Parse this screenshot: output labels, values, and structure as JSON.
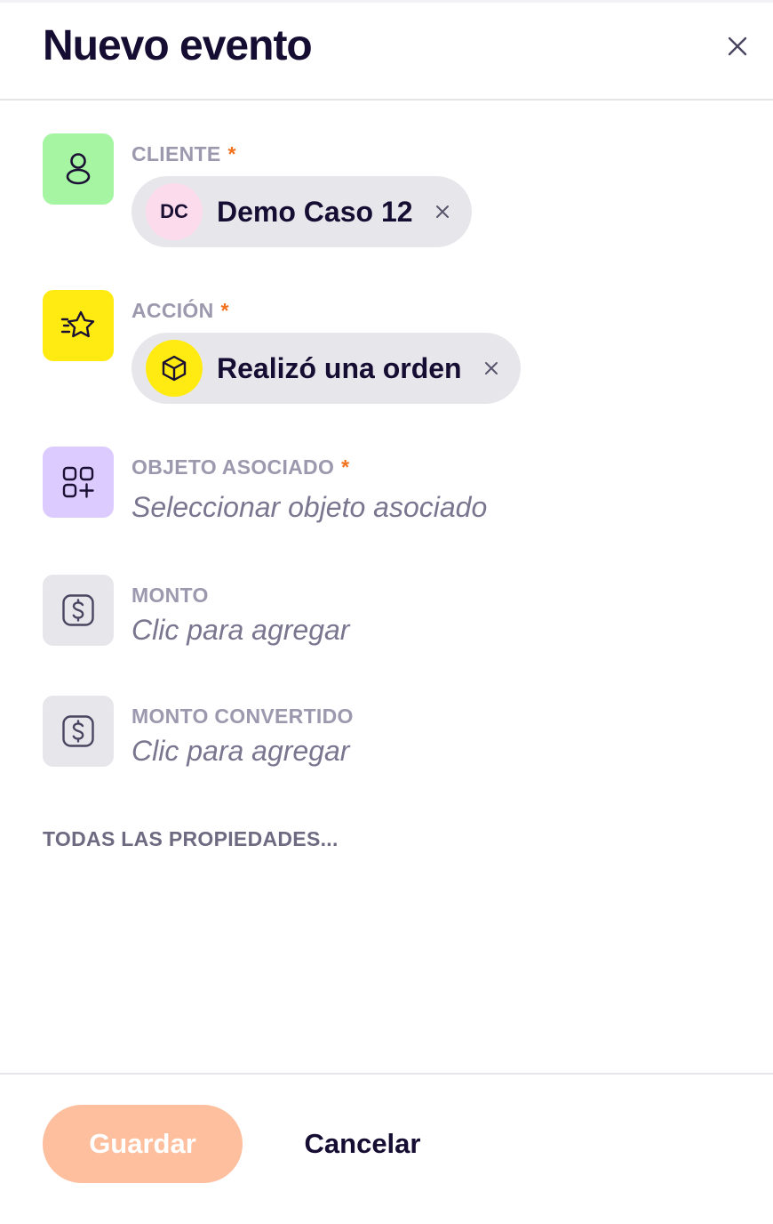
{
  "header": {
    "title": "Nuevo evento",
    "close_icon": "close-icon"
  },
  "fields": {
    "cliente": {
      "label": "CLIENTE",
      "required_mark": "*",
      "icon": "user-icon",
      "icon_bg": "#a6f5a2",
      "chip": {
        "avatar_text": "DC",
        "avatar_bg": "#fcdcec",
        "value": "Demo Caso 12"
      }
    },
    "accion": {
      "label": "ACCIÓN",
      "required_mark": "*",
      "icon": "star-motion-icon",
      "icon_bg": "#ffea12",
      "chip": {
        "avatar_icon": "box-icon",
        "avatar_bg": "#ffea12",
        "value": "Realizó una orden"
      }
    },
    "objeto": {
      "label": "OBJETO ASOCIADO",
      "required_mark": "*",
      "icon": "apps-add-icon",
      "icon_bg": "#dccbff",
      "placeholder": "Seleccionar objeto asociado"
    },
    "monto": {
      "label": "MONTO",
      "icon": "dollar-icon",
      "icon_bg": "#e7e6eb",
      "placeholder": "Clic para agregar"
    },
    "monto_convertido": {
      "label": "MONTO CONVERTIDO",
      "icon": "dollar-icon",
      "icon_bg": "#e7e6eb",
      "placeholder": "Clic para agregar"
    }
  },
  "all_properties_link": "TODAS LAS PROPIEDADES...",
  "footer": {
    "save_label": "Guardar",
    "cancel_label": "Cancelar"
  },
  "colors": {
    "accent_orange": "#f2711c",
    "save_disabled": "#fdbf9e",
    "title": "#160d33"
  }
}
